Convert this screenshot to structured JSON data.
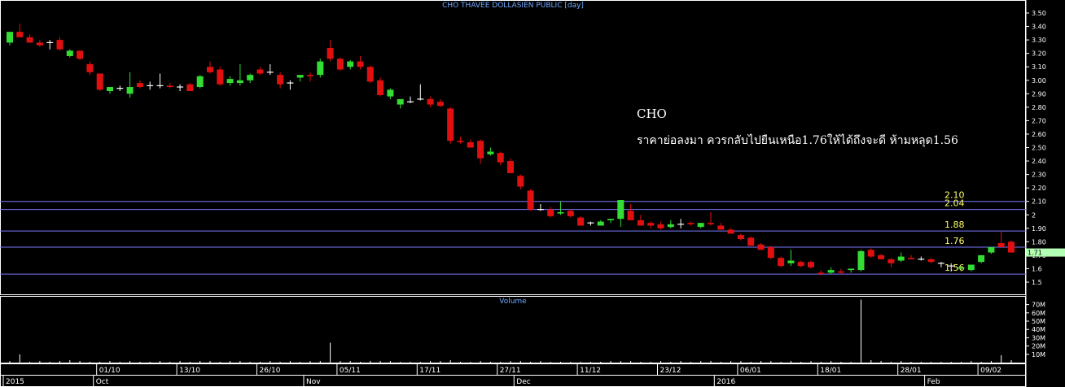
{
  "chart_data": {
    "type": "candlestick",
    "title": "CHO THAVEE DOLLASIEN PUBLIC [day]",
    "volume_title": "Volume",
    "last_price_label": "1.71",
    "annotation": {
      "title": "CHO",
      "text": "ราคาย่อลงมา ควรกลับไปยืนเหนือ1.76ให้ได้ถึงจะดี ห้ามหลุด1.56"
    },
    "ylim": [
      1.4,
      3.55
    ],
    "y_ticks": [
      "3.50",
      "3.40",
      "3.30",
      "3.20",
      "3.10",
      "3.00",
      "2.90",
      "2.80",
      "2.70",
      "2.60",
      "2.50",
      "2.40",
      "2.30",
      "2.20",
      "2.10",
      "2",
      "1.90",
      "1.80",
      "1.70",
      "1.6",
      "1.5"
    ],
    "volume_ticks": [
      "70M",
      "60M",
      "50M",
      "40M",
      "30M",
      "20M",
      "10M"
    ],
    "volume_ylim": [
      0,
      80
    ],
    "horizontal_levels": [
      {
        "value": 2.1,
        "label": "2.10"
      },
      {
        "value": 2.04,
        "label": "2.04"
      },
      {
        "value": 1.88,
        "label": "1.88"
      },
      {
        "value": 1.76,
        "label": "1.76"
      },
      {
        "value": 1.56,
        "label": "1.56"
      }
    ],
    "date_labels": [
      {
        "label": "01/10",
        "index": 9
      },
      {
        "label": "13/10",
        "index": 17
      },
      {
        "label": "26/10",
        "index": 25
      },
      {
        "label": "05/11",
        "index": 33
      },
      {
        "label": "17/11",
        "index": 41
      },
      {
        "label": "27/11",
        "index": 49
      },
      {
        "label": "11/12",
        "index": 57
      },
      {
        "label": "23/12",
        "index": 65
      },
      {
        "label": "06/01",
        "index": 73
      },
      {
        "label": "18/01",
        "index": 81
      },
      {
        "label": "28/01",
        "index": 89
      },
      {
        "label": "09/02",
        "index": 97
      }
    ],
    "period_labels": [
      {
        "label": "2015",
        "index": 0
      },
      {
        "label": "Oct",
        "index": 9
      },
      {
        "label": "Nov",
        "index": 30
      },
      {
        "label": "Dec",
        "index": 51
      },
      {
        "label": "2016",
        "index": 71
      },
      {
        "label": "Feb",
        "index": 92
      }
    ],
    "candles": [
      [
        3.28,
        3.36,
        3.26,
        3.36,
        2
      ],
      [
        3.36,
        3.42,
        3.33,
        3.32,
        10
      ],
      [
        3.32,
        3.34,
        3.28,
        3.28,
        1
      ],
      [
        3.28,
        3.3,
        3.25,
        3.26,
        2
      ],
      [
        3.28,
        3.3,
        3.23,
        3.28,
        1
      ],
      [
        3.3,
        3.32,
        3.22,
        3.23,
        2
      ],
      [
        3.18,
        3.23,
        3.17,
        3.22,
        3
      ],
      [
        3.22,
        3.22,
        3.15,
        3.16,
        2
      ],
      [
        3.12,
        3.14,
        3.04,
        3.06,
        1
      ],
      [
        3.05,
        3.05,
        2.92,
        2.93,
        1
      ],
      [
        2.92,
        2.95,
        2.9,
        2.95,
        2
      ],
      [
        2.94,
        2.96,
        2.92,
        2.94,
        1
      ],
      [
        2.9,
        3.06,
        2.87,
        2.95,
        2
      ],
      [
        2.98,
        3.0,
        2.94,
        2.95,
        1
      ],
      [
        2.96,
        2.99,
        2.93,
        2.96,
        1
      ],
      [
        2.96,
        3.05,
        2.94,
        2.96,
        2
      ],
      [
        2.96,
        2.98,
        2.94,
        2.95,
        1
      ],
      [
        2.95,
        2.97,
        2.92,
        2.95,
        2
      ],
      [
        2.97,
        2.98,
        2.92,
        2.92,
        1
      ],
      [
        2.95,
        3.04,
        2.94,
        3.03,
        2
      ],
      [
        3.1,
        3.14,
        3.05,
        3.06,
        2
      ],
      [
        3.08,
        3.1,
        2.96,
        2.97,
        1
      ],
      [
        2.98,
        3.03,
        2.96,
        3.01,
        2
      ],
      [
        2.98,
        3.12,
        2.96,
        3.0,
        2
      ],
      [
        3.0,
        3.05,
        2.98,
        3.04,
        1
      ],
      [
        3.08,
        3.1,
        3.04,
        3.05,
        1
      ],
      [
        3.06,
        3.12,
        3.04,
        3.06,
        2
      ],
      [
        3.04,
        3.06,
        2.94,
        2.97,
        1
      ],
      [
        2.98,
        3.0,
        2.93,
        2.98,
        2
      ],
      [
        3.02,
        3.04,
        2.99,
        3.04,
        1
      ],
      [
        3.04,
        3.06,
        2.99,
        3.03,
        2
      ],
      [
        3.04,
        3.16,
        3.02,
        3.14,
        2
      ],
      [
        3.24,
        3.3,
        3.14,
        3.16,
        24
      ],
      [
        3.16,
        3.17,
        3.07,
        3.08,
        2
      ],
      [
        3.1,
        3.15,
        3.08,
        3.14,
        2
      ],
      [
        3.14,
        3.18,
        3.08,
        3.1,
        1
      ],
      [
        3.1,
        3.11,
        2.98,
        2.99,
        2
      ],
      [
        3.0,
        3.02,
        2.88,
        2.89,
        2
      ],
      [
        2.88,
        2.94,
        2.86,
        2.93,
        2
      ],
      [
        2.82,
        2.86,
        2.79,
        2.86,
        1
      ],
      [
        2.84,
        2.88,
        2.83,
        2.84,
        1
      ],
      [
        2.86,
        2.97,
        2.85,
        2.86,
        1
      ],
      [
        2.86,
        2.88,
        2.8,
        2.82,
        2
      ],
      [
        2.84,
        2.86,
        2.8,
        2.81,
        2
      ],
      [
        2.79,
        2.8,
        2.53,
        2.55,
        3
      ],
      [
        2.55,
        2.58,
        2.53,
        2.54,
        1
      ],
      [
        2.54,
        2.56,
        2.5,
        2.5,
        1
      ],
      [
        2.55,
        2.56,
        2.38,
        2.42,
        2
      ],
      [
        2.45,
        2.5,
        2.44,
        2.47,
        1
      ],
      [
        2.46,
        2.47,
        2.37,
        2.39,
        1
      ],
      [
        2.4,
        2.42,
        2.31,
        2.31,
        2
      ],
      [
        2.29,
        2.3,
        2.19,
        2.21,
        2
      ],
      [
        2.18,
        2.19,
        2.03,
        2.04,
        1
      ],
      [
        2.04,
        2.08,
        2.03,
        2.04,
        2
      ],
      [
        2.04,
        2.06,
        1.98,
        1.99,
        1
      ],
      [
        2.01,
        2.1,
        2.0,
        2.02,
        1
      ],
      [
        2.03,
        2.04,
        1.98,
        1.99,
        1
      ],
      [
        1.98,
        1.99,
        1.92,
        1.92,
        1
      ],
      [
        1.94,
        1.95,
        1.92,
        1.94,
        1
      ],
      [
        1.92,
        1.96,
        1.92,
        1.95,
        1
      ],
      [
        1.96,
        1.97,
        1.94,
        1.97,
        2
      ],
      [
        1.97,
        2.11,
        1.91,
        2.11,
        2
      ],
      [
        2.03,
        2.08,
        1.96,
        1.96,
        2
      ],
      [
        1.96,
        2.0,
        1.92,
        1.92,
        1
      ],
      [
        1.94,
        1.95,
        1.9,
        1.92,
        1
      ],
      [
        1.93,
        1.95,
        1.89,
        1.9,
        2
      ],
      [
        1.91,
        1.96,
        1.9,
        1.93,
        1
      ],
      [
        1.93,
        1.97,
        1.9,
        1.93,
        2
      ],
      [
        1.94,
        1.95,
        1.92,
        1.93,
        1
      ],
      [
        1.91,
        1.94,
        1.9,
        1.94,
        2
      ],
      [
        1.94,
        2.02,
        1.92,
        1.93,
        2
      ],
      [
        1.92,
        1.94,
        1.89,
        1.89,
        1
      ],
      [
        1.89,
        1.9,
        1.86,
        1.86,
        2
      ],
      [
        1.85,
        1.86,
        1.81,
        1.82,
        2
      ],
      [
        1.83,
        1.84,
        1.77,
        1.77,
        1
      ],
      [
        1.78,
        1.79,
        1.74,
        1.74,
        2
      ],
      [
        1.76,
        1.77,
        1.67,
        1.68,
        2
      ],
      [
        1.68,
        1.69,
        1.61,
        1.62,
        1
      ],
      [
        1.64,
        1.74,
        1.62,
        1.66,
        2
      ],
      [
        1.65,
        1.66,
        1.61,
        1.62,
        1
      ],
      [
        1.65,
        1.66,
        1.6,
        1.61,
        2
      ],
      [
        1.57,
        1.59,
        1.55,
        1.56,
        1
      ],
      [
        1.57,
        1.61,
        1.56,
        1.59,
        2
      ],
      [
        1.58,
        1.6,
        1.56,
        1.57,
        1
      ],
      [
        1.59,
        1.6,
        1.57,
        1.6,
        1
      ],
      [
        1.59,
        1.74,
        1.58,
        1.73,
        76
      ],
      [
        1.74,
        1.75,
        1.68,
        1.69,
        3
      ],
      [
        1.7,
        1.71,
        1.67,
        1.67,
        2
      ],
      [
        1.67,
        1.68,
        1.61,
        1.64,
        1
      ],
      [
        1.66,
        1.72,
        1.65,
        1.69,
        2
      ],
      [
        1.68,
        1.7,
        1.67,
        1.67,
        1
      ],
      [
        1.67,
        1.69,
        1.66,
        1.67,
        1
      ],
      [
        1.67,
        1.68,
        1.64,
        1.65,
        1
      ],
      [
        1.64,
        1.65,
        1.61,
        1.64,
        1
      ],
      [
        1.62,
        1.64,
        1.58,
        1.62,
        1
      ],
      [
        1.6,
        1.62,
        1.58,
        1.61,
        1
      ],
      [
        1.59,
        1.62,
        1.58,
        1.63,
        2
      ],
      [
        1.65,
        1.7,
        1.64,
        1.7,
        1
      ],
      [
        1.72,
        1.75,
        1.71,
        1.76,
        2
      ],
      [
        1.79,
        1.88,
        1.77,
        1.76,
        9
      ],
      [
        1.8,
        1.81,
        1.72,
        1.72,
        3
      ]
    ]
  }
}
